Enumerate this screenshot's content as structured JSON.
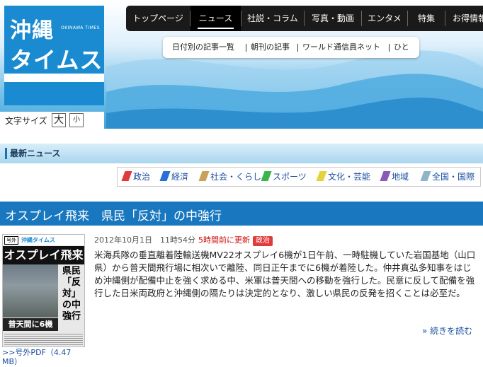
{
  "logo": {
    "line1": "沖縄",
    "line2": "タイムス",
    "en": "OKINAWA TIMES"
  },
  "font_size": {
    "label": "文字サイズ",
    "large": "大",
    "small": "小"
  },
  "main_nav": [
    {
      "label": "トップページ"
    },
    {
      "label": "ニュース",
      "active": true
    },
    {
      "label": "社説・コラム"
    },
    {
      "label": "写真・動画"
    },
    {
      "label": "エンタメ"
    },
    {
      "label": "特集"
    },
    {
      "label": "お得情報"
    }
  ],
  "sub_nav": [
    "日付別の記事一覧",
    "朝刊の記事",
    "ワールド通信員ネット",
    "ひと"
  ],
  "section": {
    "title": "最新ニュース"
  },
  "categories": [
    {
      "label": "政治",
      "color": "#e23a3a",
      "icon": "red-flag-icon"
    },
    {
      "label": "経済",
      "color": "#2a6fd6",
      "icon": "blue-flag-icon"
    },
    {
      "label": "社会・くらし",
      "color": "#c9a25a",
      "icon": "tan-flag-icon"
    },
    {
      "label": "スポーツ",
      "color": "#3ab54a",
      "icon": "green-flag-icon"
    },
    {
      "label": "文化・芸能",
      "color": "#e6d23a",
      "icon": "yellow-flag-icon"
    },
    {
      "label": "地域",
      "color": "#8a5ab8",
      "icon": "purple-flag-icon"
    },
    {
      "label": "全国・国際",
      "color": "#8fb4c8",
      "icon": "gray-blue-flag-icon"
    }
  ],
  "article": {
    "headline": "オスプレイ飛来　県民「反対」の中強行",
    "date": "2012年10月1日　11時54分",
    "updated": "5時間前に更新",
    "badge": "政治",
    "body": "米海兵隊の垂直離着陸輸送機MV22オスプレイ6機が1日午前、一時駐機していた岩国基地（山口県）から普天間飛行場に相次いで離陸、同日正午までに6機が着陸した。仲井真弘多知事をはじめ沖縄側が配備中止を強く求める中、米軍は普天間への移動を強行した。民意に反して配備を強行した日米両政府と沖縄側の隔たりは決定的となり、激しい県民の反発を招くことは必至だ。",
    "read_more": "» 続きを読む",
    "pdf_link": ">>号外PDF（4.47 MB）",
    "thumb": {
      "tag": "号外",
      "brand": "沖縄タイムス",
      "title": "オスプレイ飛来",
      "vertical": "県民「反対」の中強行",
      "bottom": "普天間に6機"
    }
  },
  "colors": {
    "brand": "#1a8bd0",
    "headline_bar": "#1877bf",
    "nav_bg": "#1a1a1a"
  }
}
